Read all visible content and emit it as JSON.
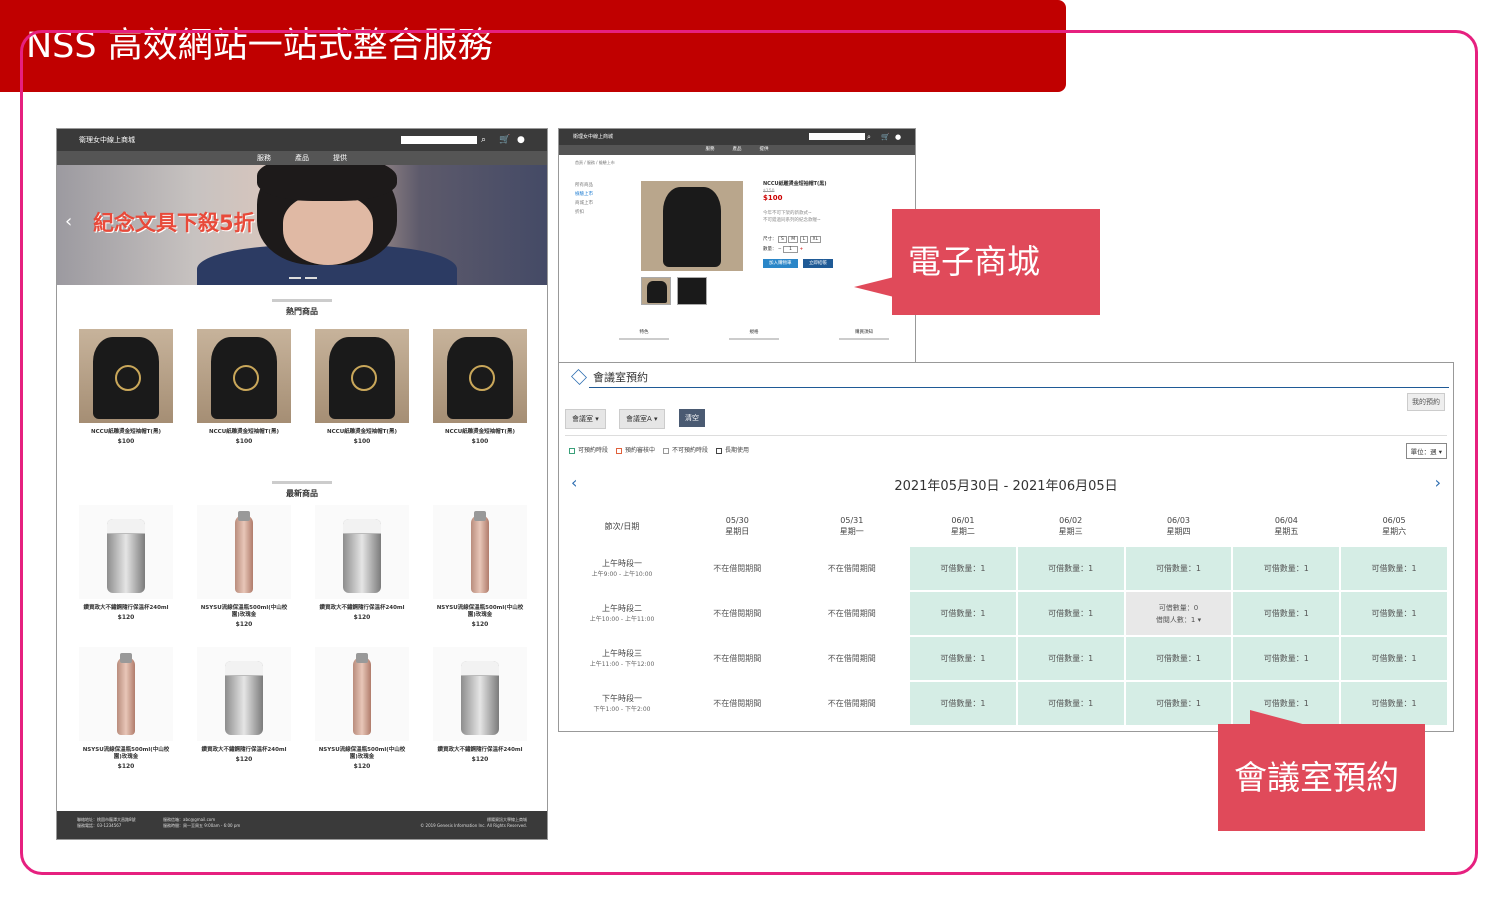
{
  "header": {
    "title": "NSS 高效網站一站式整合服務"
  },
  "shop": {
    "site_title": "衛理女中線上商城",
    "nav": [
      "服務",
      "產品",
      "提供"
    ],
    "banner_text": "紀念文具下殺5折",
    "section_hot": "熱門商品",
    "section_new": "最新商品",
    "hot_products": [
      {
        "name": "NCCU紙雕燙金短袖帽T(黑)",
        "price": "$100"
      },
      {
        "name": "NCCU紙雕燙金短袖帽T(黑)",
        "price": "$100"
      },
      {
        "name": "NCCU紙雕燙金短袖帽T(黑)",
        "price": "$100"
      },
      {
        "name": "NCCU紙雕燙金短袖帽T(黑)",
        "price": "$100"
      }
    ],
    "new_products": [
      {
        "name": "鑽資政大不鏽鋼隨行保溫杯240ml",
        "price": "$120",
        "kind": "tumbler"
      },
      {
        "name": "NSYSU流線保溫瓶500ml(中山校園)玫瑰金",
        "price": "$120",
        "kind": "bottle"
      },
      {
        "name": "鑽資政大不鏽鋼隨行保溫杯240ml",
        "price": "$120",
        "kind": "tumbler"
      },
      {
        "name": "NSYSU流線保溫瓶500ml(中山校園)玫瑰金",
        "price": "$120",
        "kind": "bottle"
      },
      {
        "name": "NSYSU流線保溫瓶500ml(中山校園)玫瑰金",
        "price": "$120",
        "kind": "bottle"
      },
      {
        "name": "鑽資政大不鏽鋼隨行保溫杯240ml",
        "price": "$120",
        "kind": "tumbler"
      },
      {
        "name": "NSYSU流線保溫瓶500ml(中山校園)玫瑰金",
        "price": "$120",
        "kind": "bottle"
      },
      {
        "name": "鑽資政大不鏽鋼隨行保溫杯240ml",
        "price": "$120",
        "kind": "tumbler"
      }
    ],
    "footer_left": [
      "聯絡地址：桃園市龍潭大昌路8號",
      "服務電話：03-1234567"
    ],
    "footer_mid": [
      "服務信箱：abc@gmail.com",
      "服務時間：周一至周五 9:00am - 6:00 pm"
    ],
    "footer_right": [
      "標陽資訊大學線上商城",
      "© 2019 Genesis Information Inc. All Rights Reserved."
    ]
  },
  "detail": {
    "site_title": "衛理女中線上商城",
    "nav": [
      "服務",
      "產品",
      "提供"
    ],
    "breadcrumb": "首頁 / 服務 / 檢驗上市",
    "side": [
      "所有商品",
      "檢驗上市",
      "商城上市",
      "折扣"
    ],
    "product_name": "NCCU紙雕燙金短袖帽T(黑)",
    "orig_price": "$150",
    "price": "$100",
    "desc": [
      "今年不可下架的新款式~",
      "不可錯過同系列的紀念款喔~"
    ],
    "size_label": "尺寸：",
    "sizes": [
      "S",
      "M",
      "L",
      "XL"
    ],
    "qty_label": "數量：",
    "qty": "1",
    "add_cart": "加入購物車",
    "buy_now": "立即結帳",
    "tabs": [
      "特色",
      "規格",
      "購買須知"
    ]
  },
  "callouts": {
    "shop": "電子商城",
    "room": "會議室預約"
  },
  "room": {
    "title": "會議室預約",
    "my_booking": "我的預約",
    "filter_room": "會議室",
    "filter_room_a": "會議室A",
    "clear": "清空",
    "legend": [
      "可預約時段",
      "預約審核中",
      "不可預約時段",
      "長期使用"
    ],
    "unit": "單位：週",
    "date_range": "2021年05月30日 - 2021年06月05日",
    "corner": "節次/日期",
    "days": [
      {
        "date": "05/30",
        "wd": "星期日"
      },
      {
        "date": "05/31",
        "wd": "星期一"
      },
      {
        "date": "06/01",
        "wd": "星期二"
      },
      {
        "date": "06/02",
        "wd": "星期三"
      },
      {
        "date": "06/03",
        "wd": "星期四"
      },
      {
        "date": "06/04",
        "wd": "星期五"
      },
      {
        "date": "06/05",
        "wd": "星期六"
      }
    ],
    "slots": [
      {
        "name": "上午時段一",
        "time": "上午9:00 - 上午10:00"
      },
      {
        "name": "上午時段二",
        "time": "上午10:00 - 上午11:00"
      },
      {
        "name": "上午時段三",
        "time": "上午11:00 - 下午12:00"
      },
      {
        "name": "下午時段一",
        "time": "下午1:00 - 下午2:00"
      }
    ],
    "not_period": "不在借閱期間",
    "avail": "可借數量：1",
    "avail_zero": "可借數量：0",
    "borrowers": "借閱人數：1 ▾"
  }
}
